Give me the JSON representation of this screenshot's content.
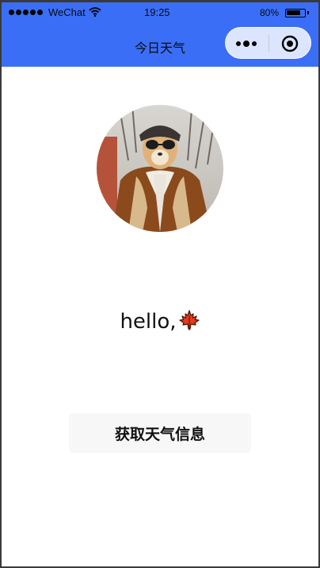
{
  "status_bar": {
    "carrier": "WeChat",
    "time": "19:25",
    "battery_text": "80%",
    "battery_level": 0.8
  },
  "nav": {
    "title": "今日天气",
    "more_icon": "more-dots-icon",
    "close_icon": "target-circle-icon"
  },
  "profile": {
    "greeting": "hello,",
    "emoji": "maple-leaf-icon"
  },
  "actions": {
    "weather_button": "获取天气信息"
  },
  "colors": {
    "nav_bar": "#3b6ef7",
    "page_bg": "#ffffff",
    "button_bg": "#f7f7f7",
    "leaf": "#e23b1c"
  }
}
